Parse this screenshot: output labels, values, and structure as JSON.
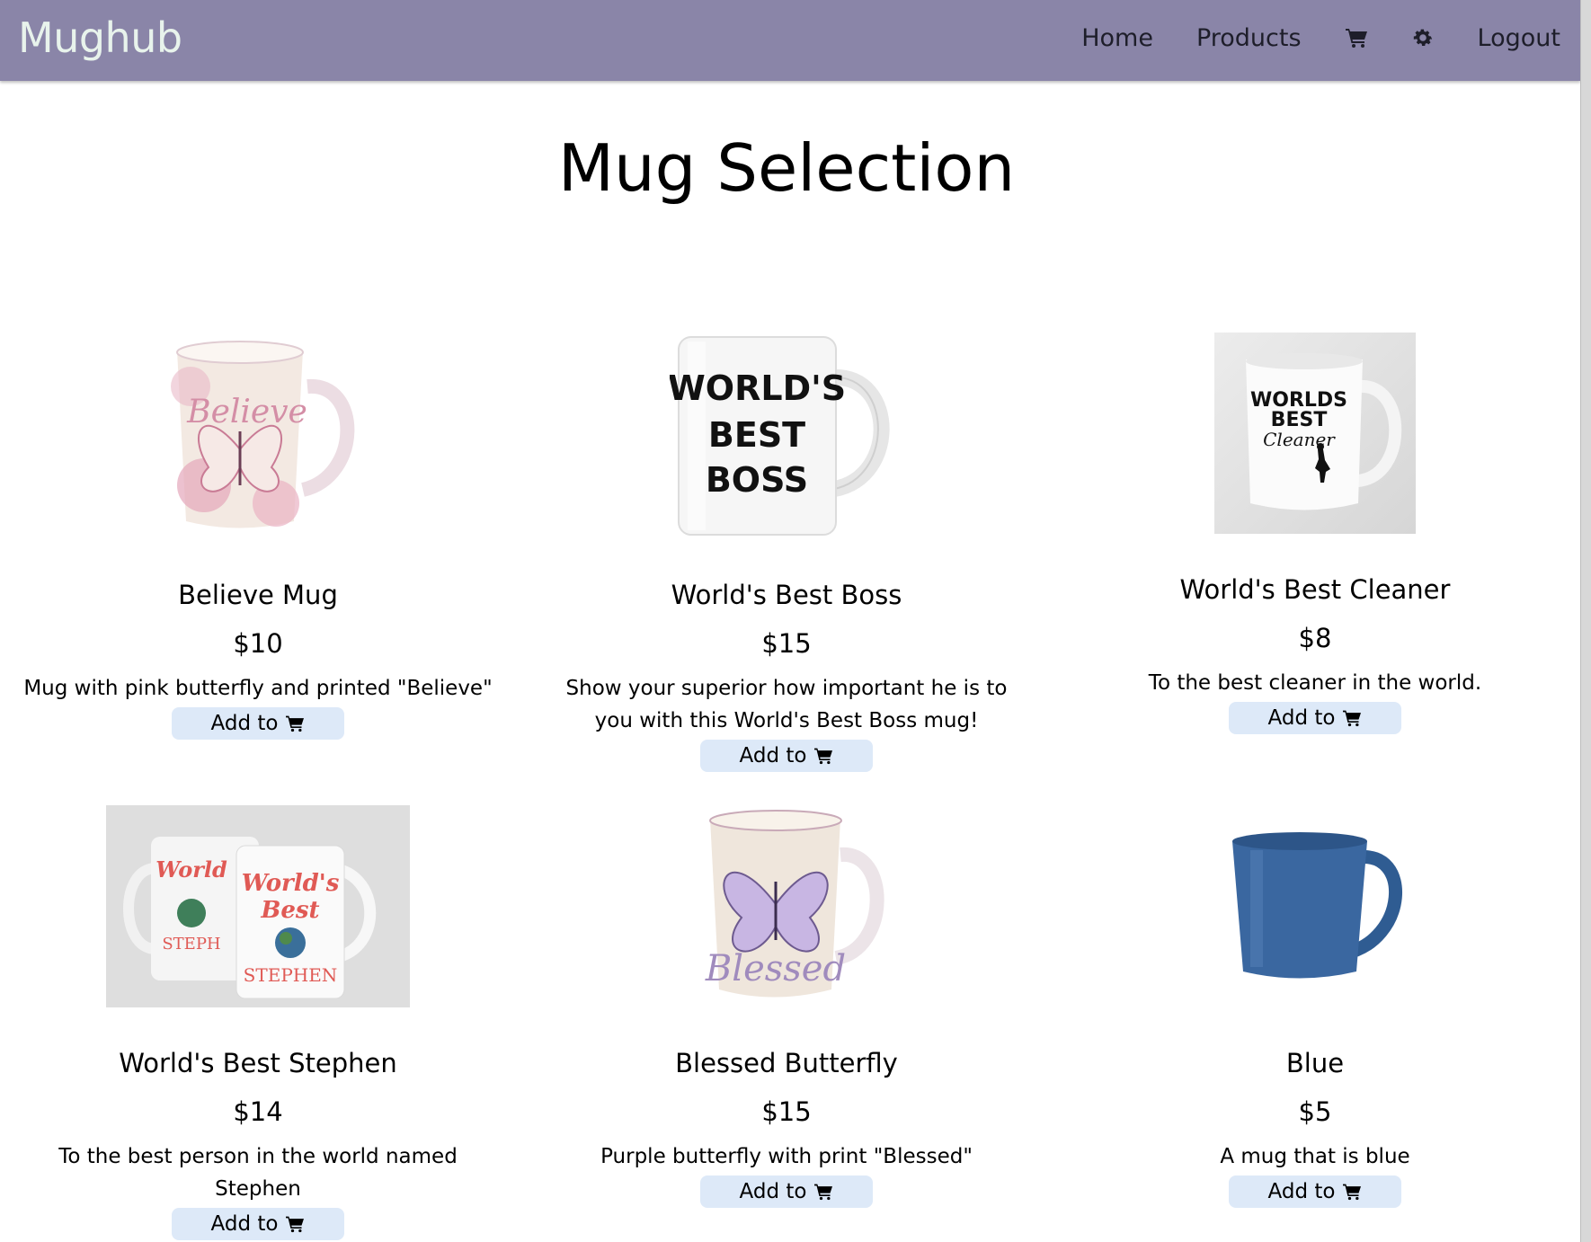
{
  "navbar": {
    "brand": "Mughub",
    "links": {
      "home": "Home",
      "products": "Products",
      "logout": "Logout"
    },
    "icons": {
      "cart": "cart-icon",
      "settings": "gear-icon"
    },
    "background_color": "#8a85a8"
  },
  "page": {
    "title": "Mug Selection"
  },
  "products": [
    {
      "name": "Believe Mug",
      "price": "$10",
      "description": "Mug with pink butterfly and printed \"Believe\"",
      "button_label": "Add to",
      "image_text": "Believe"
    },
    {
      "name": "World's Best Boss",
      "price": "$15",
      "description": "Show your superior how important he is to you with this World's Best Boss mug!",
      "button_label": "Add to",
      "image_text": "WORLD'S BEST BOSS"
    },
    {
      "name": "World's Best Cleaner",
      "price": "$8",
      "description": "To the best cleaner in the world.",
      "button_label": "Add to",
      "image_text": "WORLDS BEST Cleaner"
    },
    {
      "name": "World's Best Stephen",
      "price": "$14",
      "description": "To the best person in the world named Stephen",
      "button_label": "Add to",
      "image_text": "World's Best STEPHEN"
    },
    {
      "name": "Blessed Butterfly",
      "price": "$15",
      "description": "Purple butterfly with print \"Blessed\"",
      "button_label": "Add to",
      "image_text": "Blessed"
    },
    {
      "name": "Blue",
      "price": "$5",
      "description": "A mug that is blue",
      "button_label": "Add to",
      "image_text": ""
    }
  ],
  "colors": {
    "button_bg": "#dde9f8",
    "brand_text": "#e8f3ec"
  }
}
